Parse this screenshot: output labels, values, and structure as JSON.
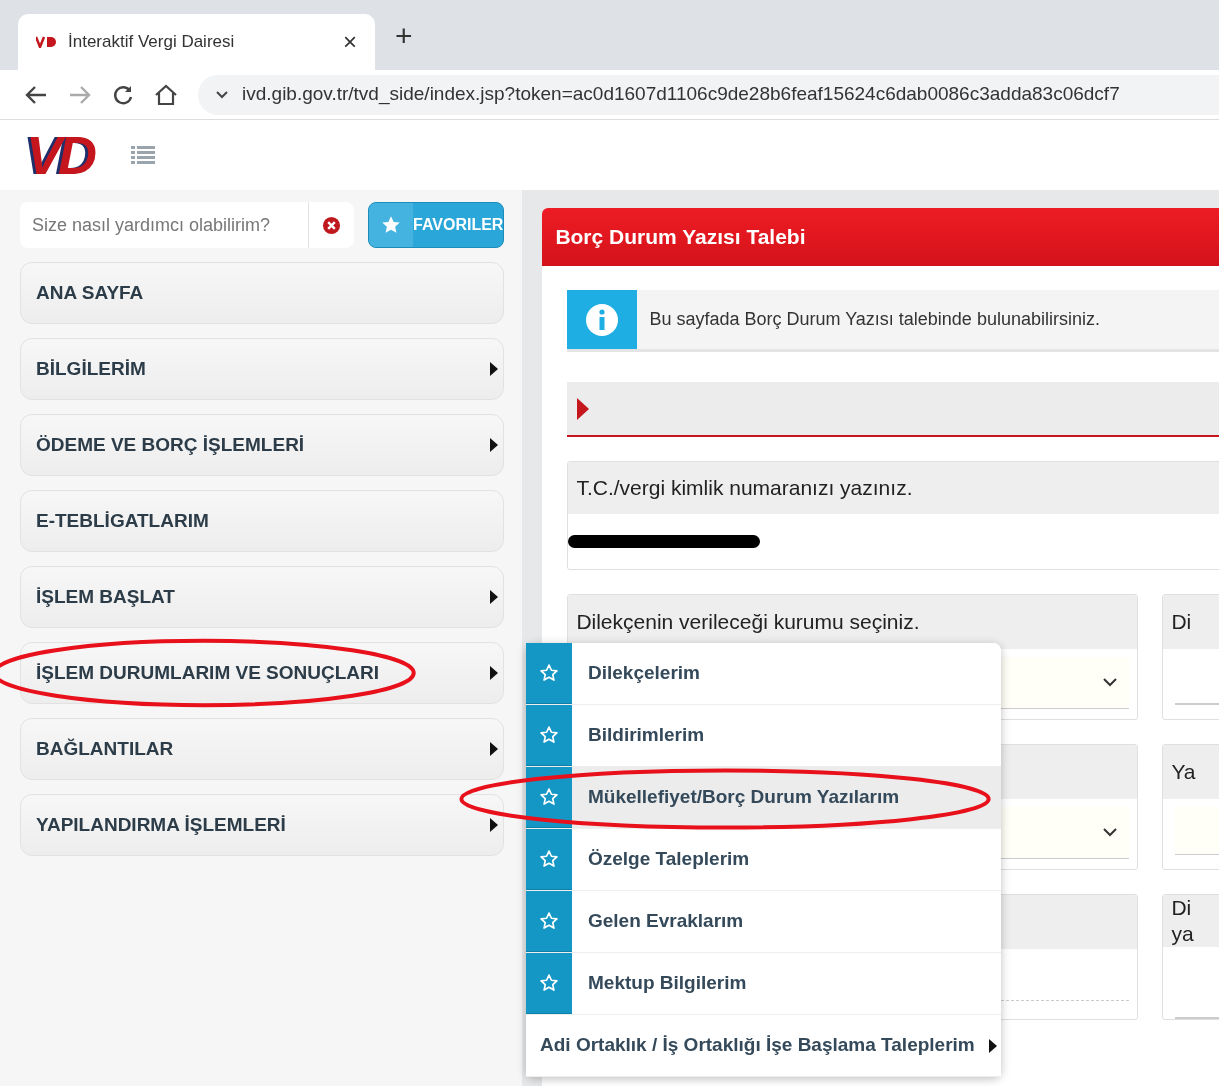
{
  "browser": {
    "tab": {
      "title": "İnteraktif Vergi Dairesi",
      "close": "×"
    },
    "new_tab": "+",
    "url": "ivd.gib.gov.tr/tvd_side/index.jsp?token=ac0d1607d1106c9de28b6feaf15624c6dab0086c3adda83c06dcf7"
  },
  "app": {
    "logo": "VD"
  },
  "sidebar": {
    "search": {
      "placeholder": "Size nasıl yardımcı olabilirim?"
    },
    "favorites_button": "FAVORILER",
    "items": [
      {
        "label": "ANA SAYFA",
        "has_submenu": false,
        "circled": false
      },
      {
        "label": "BİLGİLERİM",
        "has_submenu": true,
        "circled": false
      },
      {
        "label": "ÖDEME VE BORÇ İŞLEMLERİ",
        "has_submenu": true,
        "circled": false
      },
      {
        "label": "E-TEBLİGATLARIM",
        "has_submenu": false,
        "circled": false
      },
      {
        "label": "İŞLEM BAŞLAT",
        "has_submenu": true,
        "circled": false
      },
      {
        "label": "İŞLEM DURUMLARIM VE SONUÇLARI",
        "has_submenu": true,
        "circled": true
      },
      {
        "label": "BAĞLANTILAR",
        "has_submenu": true,
        "circled": false
      },
      {
        "label": "YAPILANDIRMA İŞLEMLERİ",
        "has_submenu": true,
        "circled": false
      }
    ]
  },
  "submenu": {
    "items": [
      {
        "label": "Dilekçelerim",
        "kind": "favorite",
        "selected": false,
        "circled": false
      },
      {
        "label": "Bildirimlerim",
        "kind": "favorite",
        "selected": false,
        "circled": false
      },
      {
        "label": "Mükellefiyet/Borç Durum Yazılarım",
        "kind": "favorite",
        "selected": true,
        "circled": true
      },
      {
        "label": "Özelge Taleplerim",
        "kind": "favorite",
        "selected": false,
        "circled": false
      },
      {
        "label": "Gelen Evraklarım",
        "kind": "favorite",
        "selected": false,
        "circled": false
      },
      {
        "label": "Mektup Bilgilerim",
        "kind": "favorite",
        "selected": false,
        "circled": false
      },
      {
        "label": "Adi Ortaklık / İş Ortaklığı İşe Başlama Taleplerim",
        "kind": "submenu",
        "selected": false,
        "circled": false
      }
    ]
  },
  "panel": {
    "title": "Borç Durum Yazısı Talebi",
    "info": "Bu sayfada Borç Durum Yazısı talebinde bulunabilirsiniz.",
    "id_field": {
      "label": "T.C./vergi kimlik numaranızı yazınız.",
      "redacted": true
    },
    "rows": [
      {
        "left": {
          "label": "Dilekçenin verileceği kurumu seçiniz.",
          "kind": "select"
        },
        "right": {
          "label_lines": [
            "Di"
          ],
          "kind": "select"
        }
      },
      {
        "left": {
          "kind": "select"
        },
        "right": {
          "label_lines": [
            "Ya"
          ],
          "kind": "input"
        }
      },
      {
        "left": {
          "kind": "text"
        },
        "right": {
          "label_lines": [
            "Di",
            "ya"
          ],
          "kind": "select"
        }
      }
    ]
  }
}
